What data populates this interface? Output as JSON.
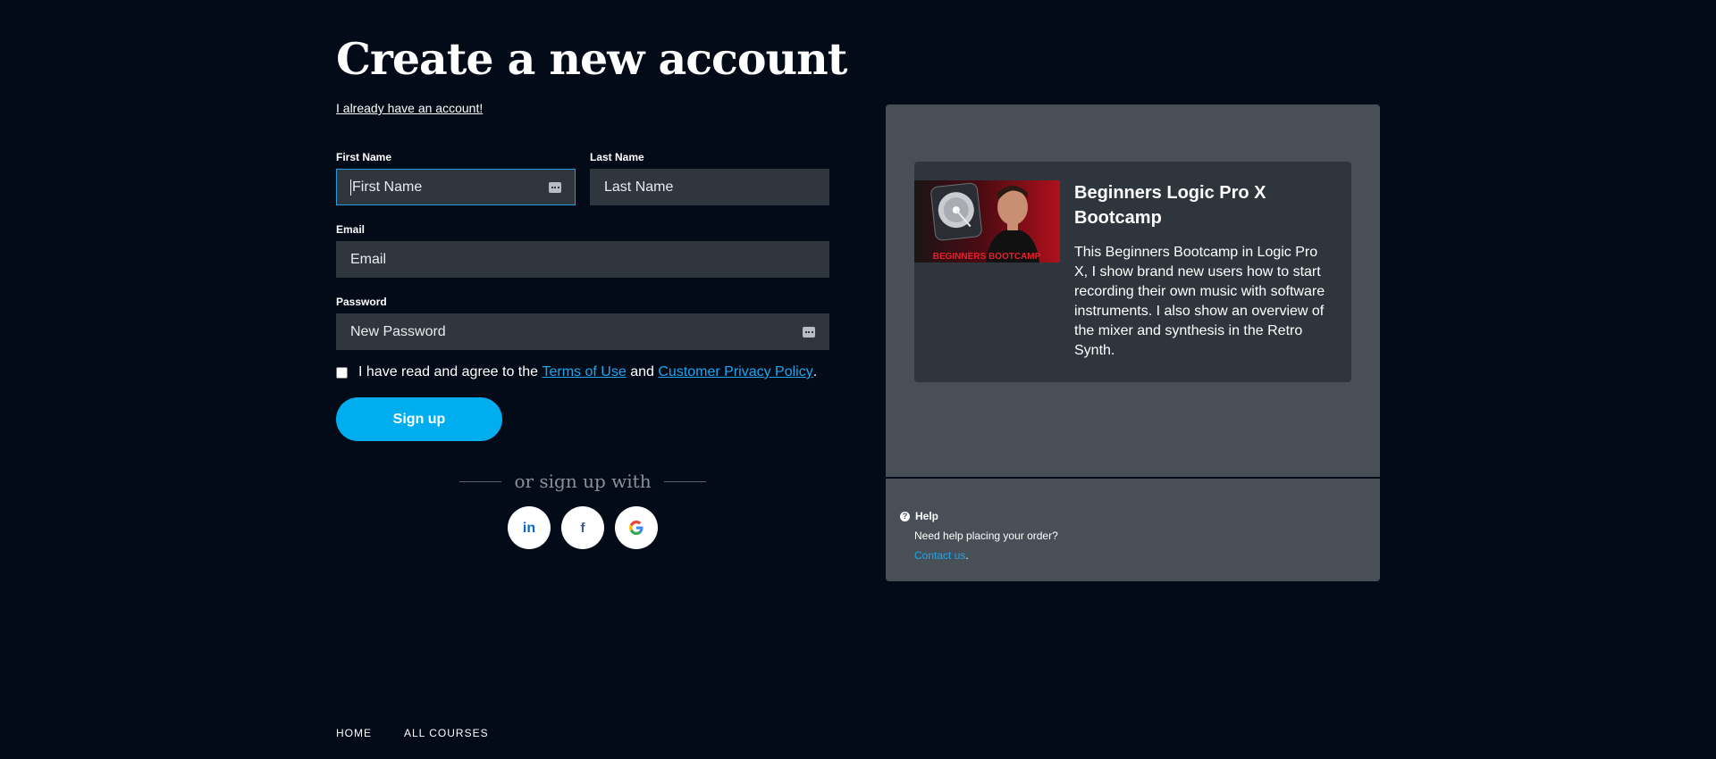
{
  "form": {
    "title": "Create a new account",
    "login_link": "I already have an account!",
    "first_name": {
      "label": "First Name",
      "placeholder": "First Name",
      "value": ""
    },
    "last_name": {
      "label": "Last Name",
      "placeholder": "Last Name",
      "value": ""
    },
    "email": {
      "label": "Email",
      "placeholder": "Email",
      "value": ""
    },
    "password": {
      "label": "Password",
      "placeholder": "New Password",
      "value": ""
    },
    "agree": {
      "checked": false,
      "prefix": "I have read and agree to the",
      "terms_link": "Terms of Use",
      "middle": "and",
      "privacy_link": "Customer Privacy Policy",
      "suffix": "."
    },
    "signup_button": "Sign up",
    "alt_signup": "or sign up with",
    "social": [
      {
        "name": "linkedin",
        "glyph": "in",
        "color": "#0a66c2"
      },
      {
        "name": "facebook",
        "glyph": "f",
        "color": "#3b5998"
      },
      {
        "name": "google",
        "glyph": "G",
        "color": "#ea4335"
      }
    ]
  },
  "summary": {
    "course": {
      "title": "Beginners Logic Pro X Bootcamp",
      "description": "This Beginners Bootcamp in Logic Pro X, I show brand new users how to start recording their own music with software instruments. I also show an overview of the mixer and synthesis in the Retro Synth.",
      "thumbnail_caption": "BEGINNERS BOOTCAMP"
    },
    "help": {
      "heading": "Help",
      "text": "Need help placing your order?",
      "contact_link": "Contact us",
      "contact_suffix": "."
    }
  },
  "footer": {
    "nav": [
      "HOME",
      "ALL COURSES"
    ]
  },
  "colors": {
    "background": "#040b18",
    "accent": "#00aeef",
    "link": "#1ba7ef",
    "panel": "#484f57",
    "card": "#2f353d",
    "input": "#30363e"
  }
}
